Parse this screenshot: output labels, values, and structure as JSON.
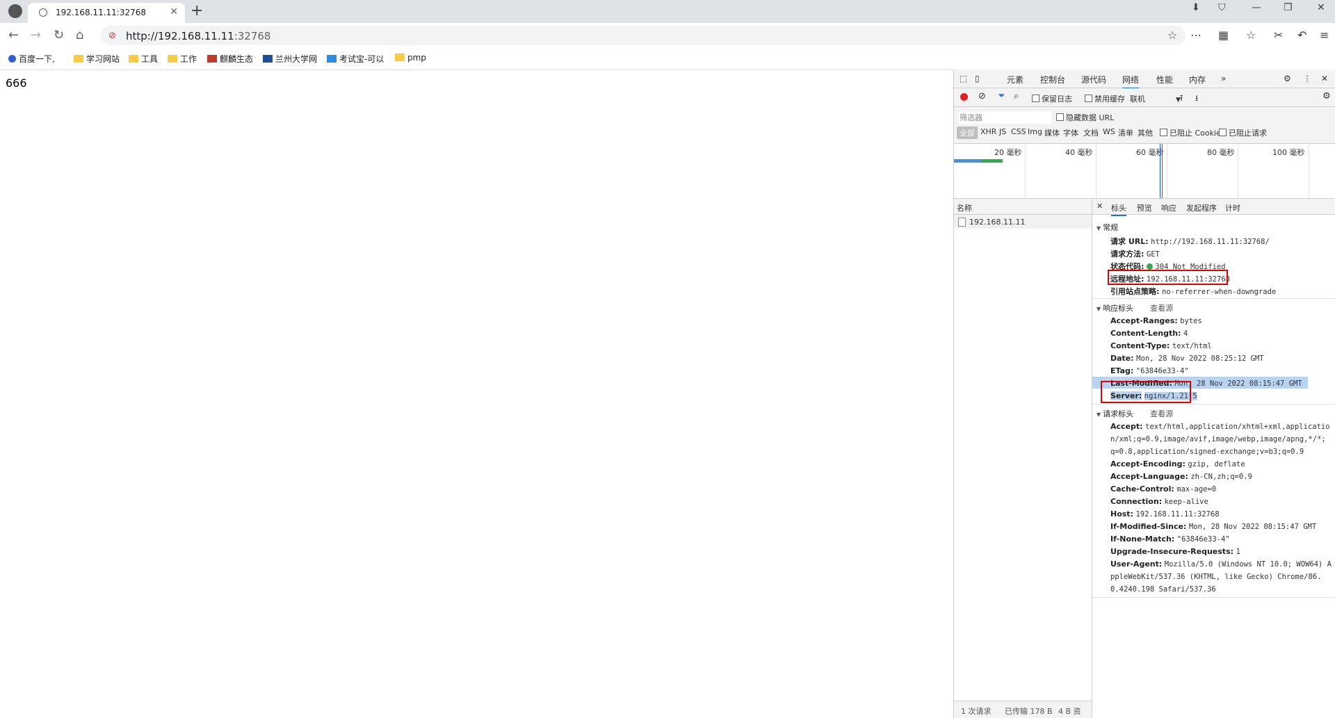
{
  "browser": {
    "tab_title": "192.168.11.11:32768",
    "new_tab": "+",
    "url_scheme_host": "http://192.168.11.11",
    "url_port": ":32768"
  },
  "bookmarks": [
    {
      "label": "百度一下,",
      "icon": "paw-icon"
    },
    {
      "label": "学习网站",
      "icon": "folder-icon"
    },
    {
      "label": "工具",
      "icon": "folder-icon"
    },
    {
      "label": "工作",
      "icon": "folder-icon"
    },
    {
      "label": "麒麟生态",
      "icon": "site-icon"
    },
    {
      "label": "兰州大学网",
      "icon": "site-icon"
    },
    {
      "label": "考试宝-可以",
      "icon": "site-icon"
    },
    {
      "label": "pmp",
      "icon": "folder-icon"
    }
  ],
  "page": {
    "body_text": "666"
  },
  "devtools": {
    "tabs": [
      "元素",
      "控制台",
      "源代码",
      "网络",
      "性能",
      "内存"
    ],
    "more": "»",
    "preserve_log": "保留日志",
    "disable_cache": "禁用缓存",
    "throttle": "联机",
    "filter_placeholder": "筛选器",
    "hide_data_url": "隐藏数据 URL",
    "type_filters": [
      "全部",
      "XHR",
      "JS",
      "CSS",
      "Img",
      "媒体",
      "字体",
      "文档",
      "WS",
      "清单",
      "其他"
    ],
    "blocked_cookies": "已阻止 Cookie",
    "blocked_requests": "已阻止请求",
    "timeline_ticks": [
      "20 毫秒",
      "40 毫秒",
      "60 毫秒",
      "80 毫秒",
      "100 毫秒"
    ],
    "name_header": "名称",
    "request_name": "192.168.11.11",
    "status_requests": "1 次请求",
    "status_transferred": "已传输 178 B",
    "status_resources": "4 B 资",
    "detail_tabs": [
      "标头",
      "预览",
      "响应",
      "发起程序",
      "计时"
    ],
    "general": {
      "title": "常规",
      "request_url_k": "请求 URL:",
      "request_url_v": "http://192.168.11.11:32768/",
      "method_k": "请求方法:",
      "method_v": "GET",
      "status_k": "状态代码:",
      "status_v": "304 Not Modified",
      "remote_k": "远程地址:",
      "remote_v": "192.168.11.11:32768",
      "referrer_k": "引用站点策略:",
      "referrer_v": "no-referrer-when-downgrade"
    },
    "response_headers": {
      "title": "响应标头",
      "view_source": "查看源",
      "items": [
        {
          "k": "Accept-Ranges:",
          "v": "bytes"
        },
        {
          "k": "Content-Length:",
          "v": "4"
        },
        {
          "k": "Content-Type:",
          "v": "text/html"
        },
        {
          "k": "Date:",
          "v": "Mon, 28 Nov 2022 08:25:12 GMT"
        },
        {
          "k": "ETag:",
          "v": "\"63846e33-4\""
        },
        {
          "k": "Last-Modified:",
          "v": "Mon, 28 Nov 2022 08:15:47 GMT"
        },
        {
          "k": "Server:",
          "v": "nginx/1.21.5"
        }
      ]
    },
    "request_headers": {
      "title": "请求标头",
      "view_source": "查看源",
      "accept_k": "Accept:",
      "accept_v1": "text/html,application/xhtml+xml,applicatio",
      "accept_v2": "n/xml;q=0.9,image/avif,image/webp,image/apng,*/*;",
      "accept_v3": "q=0.8,application/signed-exchange;v=b3;q=0.9",
      "items": [
        {
          "k": "Accept-Encoding:",
          "v": "gzip, deflate"
        },
        {
          "k": "Accept-Language:",
          "v": "zh-CN,zh;q=0.9"
        },
        {
          "k": "Cache-Control:",
          "v": "max-age=0"
        },
        {
          "k": "Connection:",
          "v": "keep-alive"
        },
        {
          "k": "Host:",
          "v": "192.168.11.11:32768"
        },
        {
          "k": "If-Modified-Since:",
          "v": "Mon, 28 Nov 2022 08:15:47 GMT"
        },
        {
          "k": "If-None-Match:",
          "v": "\"63846e33-4\""
        },
        {
          "k": "Upgrade-Insecure-Requests:",
          "v": "1"
        }
      ],
      "ua_k": "User-Agent:",
      "ua_v1": "Mozilla/5.0 (Windows NT 10.0; WOW64) A",
      "ua_v2": "ppleWebKit/537.36 (KHTML, like Gecko) Chrome/86.",
      "ua_v3": "0.4240.198 Safari/537.36"
    }
  },
  "colors": {
    "highlight_box": "#e00000",
    "status_dot": "#34a853",
    "record": "#e02020",
    "accent": "#1a73e8"
  }
}
